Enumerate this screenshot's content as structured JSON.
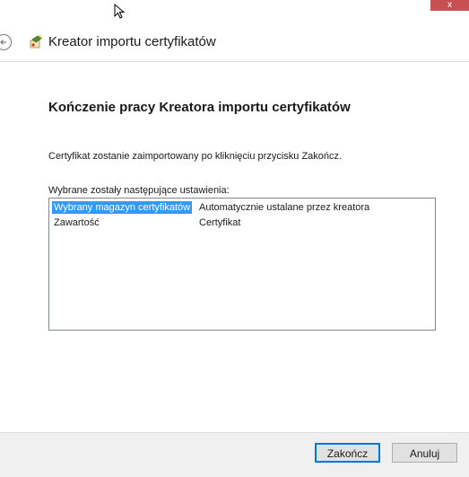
{
  "window": {
    "title": "Kreator importu certyfikatów",
    "close_label": "x"
  },
  "page": {
    "heading": "Kończenie pracy Kreatora importu certyfikatów",
    "description": "Certyfikat zostanie zaimportowany po kliknięciu przycisku Zakończ.",
    "settings_label": "Wybrane zostały następujące ustawienia:"
  },
  "settings": [
    {
      "key": "Wybrany magazyn certyfikatów",
      "value": "Automatycznie ustalane przez kreatora",
      "selected": true
    },
    {
      "key": "Zawartość",
      "value": "Certyfikat",
      "selected": false
    }
  ],
  "footer": {
    "finish_label": "Zakończ",
    "cancel_label": "Anuluj"
  },
  "colors": {
    "selection": "#3399ff",
    "close": "#c75050",
    "default_button_border": "#0078d7"
  },
  "icons": [
    "back-arrow-icon",
    "certificate-wizard-icon",
    "mouse-cursor-icon"
  ]
}
